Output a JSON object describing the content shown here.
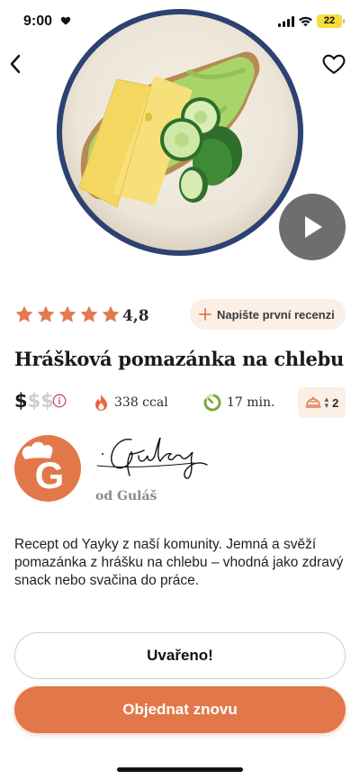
{
  "status_bar": {
    "time": "9:00",
    "battery": "22"
  },
  "icons": {
    "back": "chevron-left-icon",
    "favorite": "heart-outline-icon",
    "play": "play-icon",
    "star": "star-filled-icon",
    "plus": "plus-icon",
    "info": "info-circle-icon",
    "calories": "flame-icon",
    "time": "timer-icon",
    "servings": "serving-dish-icon"
  },
  "rating": {
    "stars": 5,
    "value": "4,8",
    "review_button_label": "Napište první recenzi"
  },
  "recipe": {
    "title": "Hrášková pomazánka na chlebu",
    "price_active": "$",
    "price_inactive": "$$",
    "calories": "338 ccal",
    "time": "17 min.",
    "servings": "2",
    "description": "Recept od Yayky z naší komunity. Jemná a svěží pomazánka z hrášku na chlebu – vhodná jako zdravý snack nebo svačina do práce."
  },
  "author": {
    "avatar_letter": "G",
    "signature": "Guláš",
    "by_line": "od Guláš"
  },
  "actions": {
    "cooked_label": "Uvařeno!",
    "order_label": "Objednat znovu"
  },
  "colors": {
    "accent": "#e27849",
    "accent_light": "#fcefe6",
    "star": "#e07b50"
  }
}
